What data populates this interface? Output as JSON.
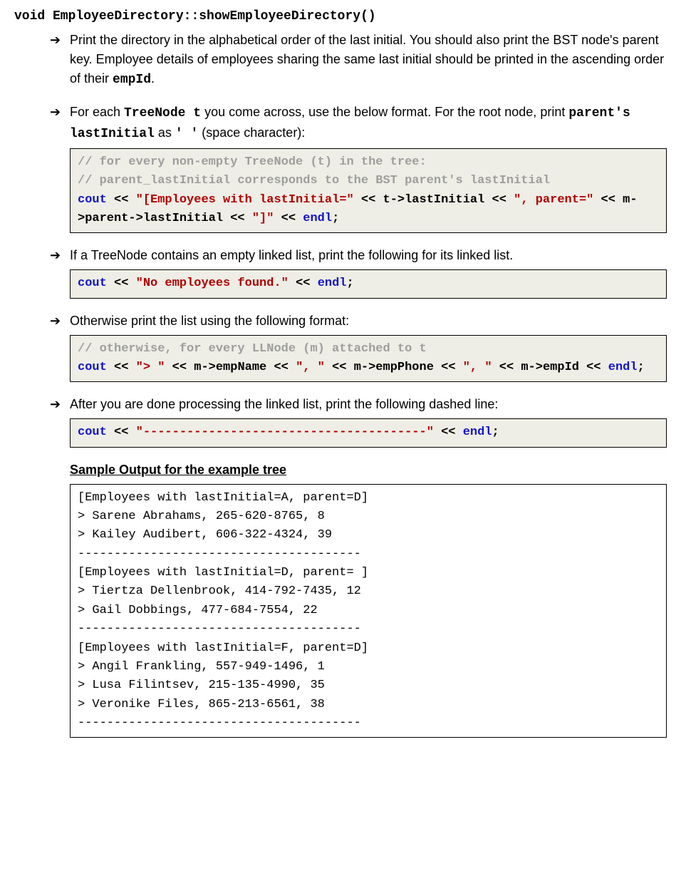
{
  "signature": "void EmployeeDirectory::showEmployeeDirectory()",
  "bullets": {
    "b1": "Print the directory in the alphabetical order of the last initial. You should also print the BST node's parent key. Employee details of employees sharing the same last initial should be printed in the ascending order of their ",
    "b1_code": "empId",
    "b1_end": ".",
    "b2a": "For each ",
    "b2a_code": "TreeNode t",
    "b2b": " you come across, use the below format. For the root node, print ",
    "b2b_code": "parent's lastInitial",
    "b2c": " as ",
    "b2c_code": "' '",
    "b2d": " (space character):",
    "b3": "If a TreeNode contains an empty linked list, print the following for its linked list.",
    "b4": "Otherwise print the list using the following format:",
    "b5": "After you are done processing the linked list, print the following dashed line:"
  },
  "code1": {
    "c1": "// for every non-empty TreeNode (t) in the tree:",
    "c2": "// parent_lastInitial corresponds to the BST parent's lastInitial",
    "kw1": "cout",
    "op1": " << ",
    "s1": "\"[Employees with lastInitial=\"",
    "op2": " << t->lastInitial << ",
    "s2": "\", parent=\"",
    "op3": " << m->parent->lastInitial << ",
    "s3": "\"]\"",
    "op4": " << ",
    "kw2": "endl",
    "semi": ";"
  },
  "code2": {
    "kw1": "cout",
    "op1": " << ",
    "s1": "\"No employees found.\"",
    "op2": " << ",
    "kw2": "endl",
    "semi": ";"
  },
  "code3": {
    "c1": "// otherwise, for every LLNode (m) attached to t",
    "kw1": "cout",
    "op1": " << ",
    "s1": "\"> \"",
    "op2": " << m->empName << ",
    "s2": "\", \"",
    "op3": " << m->empPhone << ",
    "s3": "\", \"",
    "op4": " << m->empId << ",
    "kw2": "endl",
    "semi": ";"
  },
  "code4": {
    "kw1": "cout",
    "op1": " << ",
    "s1": "\"---------------------------------------\"",
    "op2": " << ",
    "kw2": "endl",
    "semi": ";"
  },
  "sample": {
    "heading": "Sample Output for the example tree",
    "lines": "[Employees with lastInitial=A, parent=D]\n> Sarene Abrahams, 265-620-8765, 8\n> Kailey Audibert, 606-322-4324, 39\n---------------------------------------\n[Employees with lastInitial=D, parent= ]\n> Tiertza Dellenbrook, 414-792-7435, 12\n> Gail Dobbings, 477-684-7554, 22\n---------------------------------------\n[Employees with lastInitial=F, parent=D]\n> Angil Frankling, 557-949-1496, 1\n> Lusa Filintsev, 215-135-4990, 35\n> Veronike Files, 865-213-6561, 38\n---------------------------------------"
  }
}
